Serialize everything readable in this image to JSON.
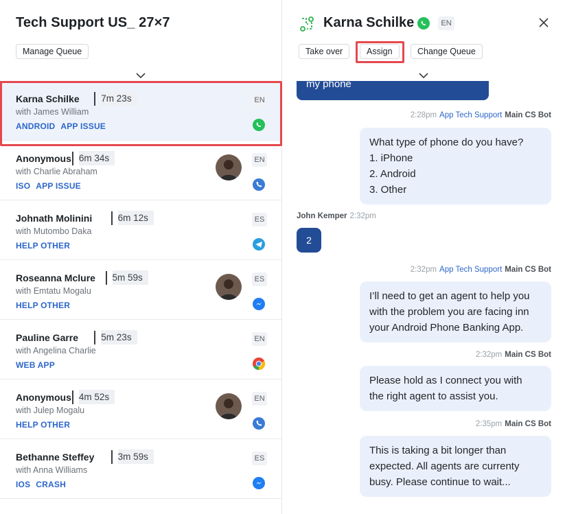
{
  "queue": {
    "title": "Tech Support US_ 27×7",
    "manage_label": "Manage Queue"
  },
  "conversations": [
    {
      "name": "Karna Schilke",
      "time": "7m 23s",
      "with": "with James William",
      "tags": [
        "ANDROID",
        "APP ISSUE"
      ],
      "lang": "EN",
      "channel": "whatsapp-icon",
      "avatar": false
    },
    {
      "name": "Anonymous",
      "time": "6m 34s",
      "with": "with Charlie Abraham",
      "tags": [
        "ISO",
        "APP ISSUE"
      ],
      "lang": "EN",
      "channel": "phone-icon",
      "avatar": true
    },
    {
      "name": "Johnath Molinini",
      "time": "6m 12s",
      "with": "with Mutombo Daka",
      "tags": [
        "HELP OTHER"
      ],
      "lang": "ES",
      "channel": "telegram-icon",
      "avatar": false
    },
    {
      "name": "Roseanna Mclure",
      "time": "5m 59s",
      "with": "with Emtatu Mogalu",
      "tags": [
        "HELP OTHER"
      ],
      "lang": "ES",
      "channel": "messenger-icon",
      "avatar": true
    },
    {
      "name": "Pauline Garre",
      "time": "5m 23s",
      "with": "with Angelina  Charlie",
      "tags": [
        "WEB APP"
      ],
      "lang": "EN",
      "channel": "chrome-icon",
      "avatar": false
    },
    {
      "name": "Anonymous",
      "time": "4m 52s",
      "with": "with Julep  Mogalu",
      "tags": [
        "HELP OTHER"
      ],
      "lang": "EN",
      "channel": "phone-icon",
      "avatar": true
    },
    {
      "name": "Bethanne Steffey",
      "time": "3m 59s",
      "with": "with Anna Williams",
      "tags": [
        "IOS",
        "CRASH"
      ],
      "lang": "ES",
      "channel": "messenger-icon",
      "avatar": false
    }
  ],
  "chat_header": {
    "name": "Karna Schilke",
    "lang": "EN",
    "take_over_label": "Take over",
    "assign_label": "Assign",
    "change_queue_label": "Change Queue"
  },
  "messages": {
    "partial_incoming": "my phone",
    "m1_time": "2:28pm",
    "m1_source": "App Tech Support",
    "m1_bot": "Main CS Bot",
    "m1_text": "What type of phone do you have?\n1. iPhone\n2. Android\n3. Other",
    "m2_sender": "John Kemper",
    "m2_time": "2:32pm",
    "m2_text": "2",
    "m3_time": "2:32pm",
    "m3_source": "App Tech Support",
    "m3_bot": "Main CS Bot",
    "m3_text": "I’ll need to get an agent to help you\nwith the problem you are facing inn\nyour Android Phone Banking App.",
    "m4_time": "2:32pm",
    "m4_bot": "Main CS Bot",
    "m4_text": "Please hold as I connect you with\nthe right agent to assist you.",
    "m5_time": "2:35pm",
    "m5_bot": "Main CS Bot",
    "m5_text": "This is taking a bit longer than\nexpected. All agents are currenty\nbusy. Please continue to wait..."
  },
  "colors": {
    "accent": "#2d66c9",
    "highlight": "#e5484d",
    "bubble_out": "#eaf0fb",
    "bubble_in": "#234c96"
  }
}
